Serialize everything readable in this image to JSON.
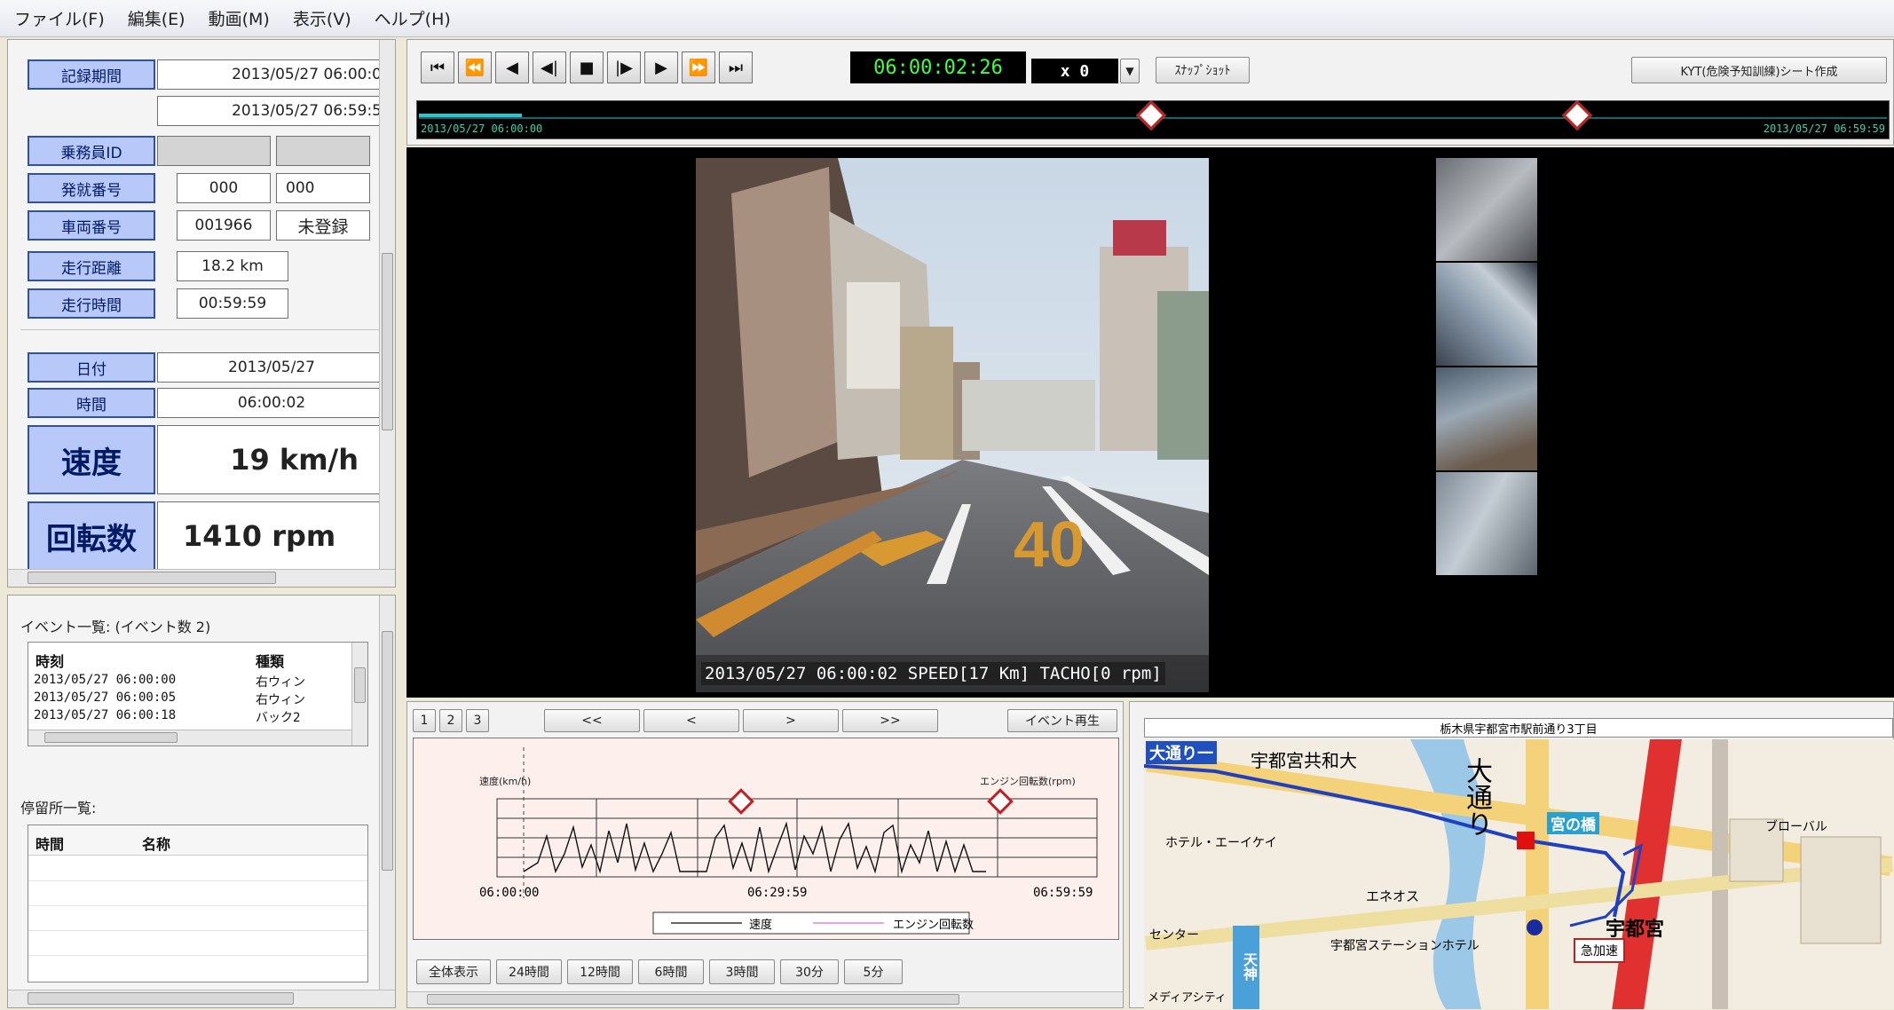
{
  "menu": [
    "ファイル(F)",
    "編集(E)",
    "動画(M)",
    "表示(V)",
    "ヘルプ(H)"
  ],
  "info": {
    "record_period_label": "記録期間",
    "record_start": "2013/05/27 06:00:0",
    "record_end": "2013/05/27 06:59:5",
    "crew_id_label": "乗務員ID",
    "origin_label": "発就番号",
    "origin_val1": "000",
    "origin_val2": "000",
    "vehicle_label": "車両番号",
    "vehicle_val": "001966",
    "vehicle_status": "未登録",
    "distance_label": "走行距離",
    "distance_val": "18.2 km",
    "time_label": "走行時間",
    "time_val": "00:59:59",
    "date_label": "日付",
    "date_val": "2013/05/27",
    "clock_label": "時間",
    "clock_val": "06:00:02",
    "speed_label": "速度",
    "speed_val": "19 km/h",
    "rpm_label": "回転数",
    "rpm_val": "1410 rpm"
  },
  "events": {
    "title": "イベント一覧: (イベント数 2)",
    "col_time": "時刻",
    "col_type": "種類",
    "rows": [
      {
        "time": "2013/05/27 06:00:00",
        "type": "右ウィン"
      },
      {
        "time": "2013/05/27 06:00:05",
        "type": "右ウィン"
      },
      {
        "time": "2013/05/27 06:00:18",
        "type": "バック2"
      }
    ]
  },
  "stops": {
    "title": "停留所一覧:",
    "col_time": "時間",
    "col_name": "名称"
  },
  "player": {
    "timecode": "06:00:02:26",
    "speed_mult": "x 0",
    "snapshot_label": "ｽﾅｯﾌﾟｼｮｯﾄ",
    "kyt_label": "KYT(危険予知訓練)シート作成",
    "timeline_start": "2013/05/27 06:00:00",
    "timeline_end": "2013/05/27 06:59:59",
    "timeline_progress": 0.07,
    "event_marker_positions": [
      0.5,
      0.79
    ]
  },
  "video": {
    "overlay": "2013/05/27 06:00:02 SPEED[17 Km] TACHO[0 rpm]",
    "road_marking": "40"
  },
  "graph": {
    "tabs": [
      "1",
      "2",
      "3"
    ],
    "nav": [
      "<<",
      "<",
      ">",
      ">>"
    ],
    "event_replay_label": "イベント再生",
    "speed_axis": "速度(km/h)",
    "rpm_axis": "エンジン回転数(rpm)",
    "x_start": "06:00:00",
    "x_mid": "06:29:59",
    "x_end": "06:59:59",
    "legend_speed": "速度",
    "legend_rpm": "エンジン回転数",
    "ranges": [
      "全体表示",
      "24時間",
      "12時間",
      "6時間",
      "3時間",
      "30分",
      "5分"
    ]
  },
  "map": {
    "title": "栃木県宇都宮市駅前通り3丁目",
    "labels": {
      "odori": "大通り一",
      "univ": "宇都宮共和大",
      "odori_v": "大通り",
      "miyanohashi": "宮の橋",
      "tower": "宇都宮",
      "hotel_left": "ホテル・エーイケイ",
      "eneos": "エネオス",
      "station_hotel": "宇都宮ステーションホテル",
      "brake": "急加速",
      "tenjin": "天神",
      "media": "メディアシティ",
      "bazaar": "ブローバル",
      "center": "センター"
    },
    "colors": {
      "route": "#2040c0",
      "rail": "#e03030",
      "road_major": "#f4d27a",
      "water": "#9cc8e8"
    }
  }
}
